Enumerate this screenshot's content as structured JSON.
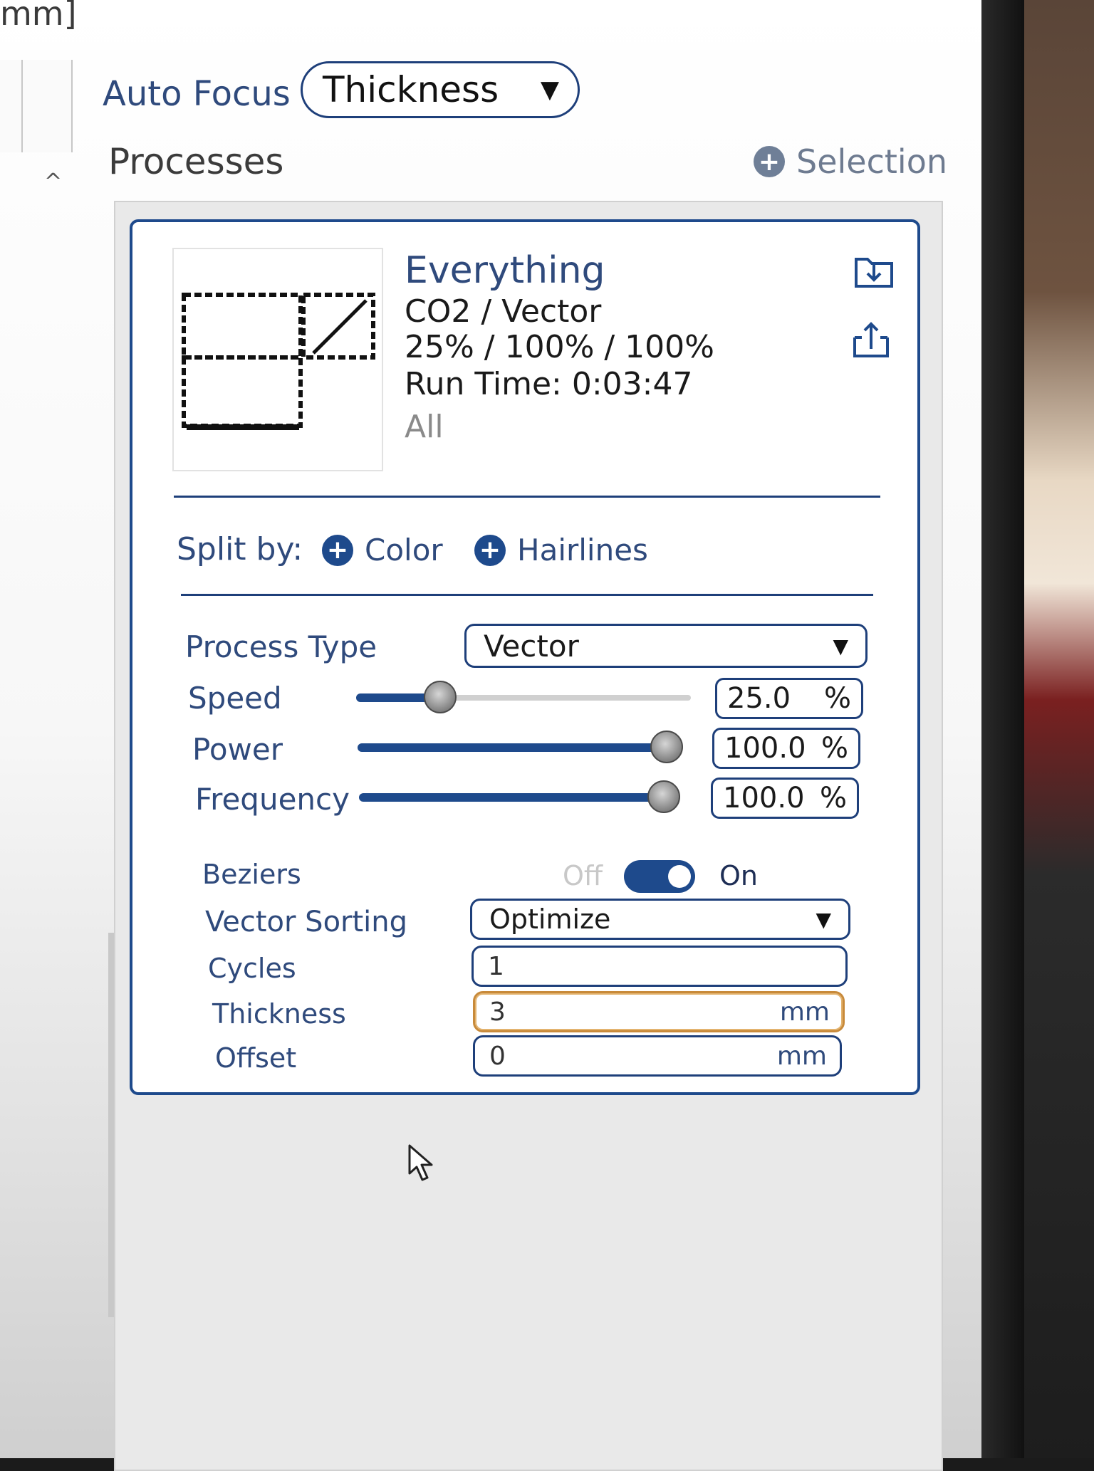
{
  "top": {
    "unit_fragment": "mm]"
  },
  "auto_focus": {
    "label": "Auto Focus",
    "value": "Thickness"
  },
  "processes": {
    "title": "Processes",
    "selection_label": "Selection"
  },
  "process": {
    "name": "Everything",
    "laser_mode": "CO2 / Vector",
    "settings_summary": "25% / 100% / 100%",
    "run_time": "Run Time: 0:03:47",
    "scope": "All"
  },
  "split_by": {
    "label": "Split by:",
    "color_label": "Color",
    "hairlines_label": "Hairlines"
  },
  "fields": {
    "process_type": {
      "label": "Process Type",
      "value": "Vector"
    },
    "speed": {
      "label": "Speed",
      "value": "25.0",
      "unit": "%",
      "level": 25
    },
    "power": {
      "label": "Power",
      "value": "100.0",
      "unit": "%",
      "level": 100
    },
    "frequency": {
      "label": "Frequency",
      "value": "100.0",
      "unit": "%",
      "level": 100
    },
    "beziers": {
      "label": "Beziers",
      "off_label": "Off",
      "on_label": "On",
      "state": "on"
    },
    "vector_sorting": {
      "label": "Vector Sorting",
      "value": "Optimize"
    },
    "cycles": {
      "label": "Cycles",
      "value": "1"
    },
    "thickness": {
      "label": "Thickness",
      "value": "3",
      "unit": "mm"
    },
    "offset": {
      "label": "Offset",
      "value": "0",
      "unit": "mm"
    }
  },
  "colors": {
    "accent": "#1e4a8c",
    "label_text": "#2f4a7c",
    "focus_border": "#c88a3a"
  },
  "icons": [
    "plus-circle-icon",
    "import-icon",
    "export-icon",
    "chevron-down-icon",
    "chevron-up-icon",
    "mouse-pointer-icon"
  ]
}
